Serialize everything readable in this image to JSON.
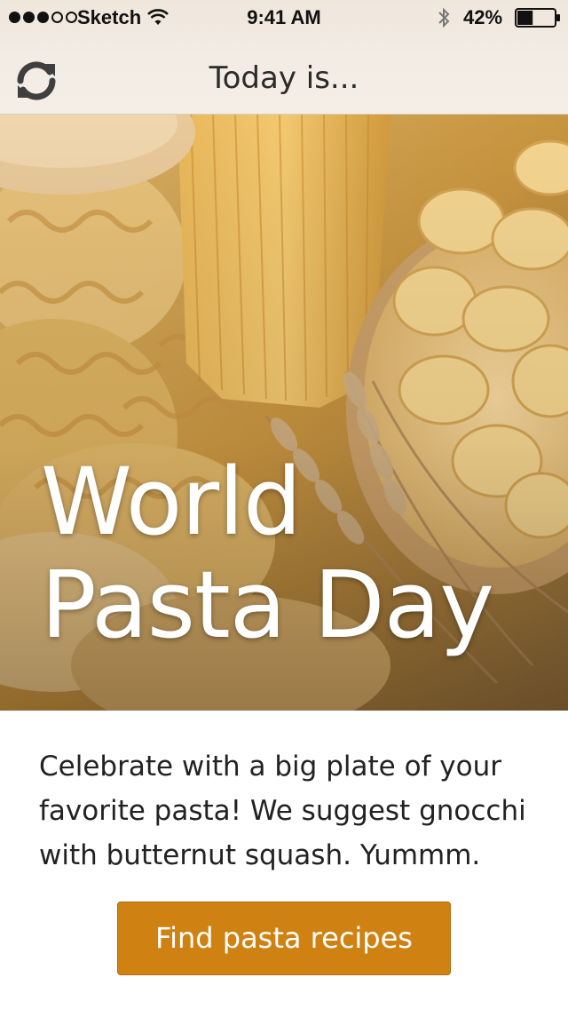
{
  "status_bar": {
    "carrier": "Sketch",
    "time": "9:41 AM",
    "battery": "42%",
    "signal_strength": 3,
    "signal_max": 5,
    "battery_level": 0.42
  },
  "nav": {
    "title": "Today is...",
    "refresh_icon": "refresh-icon"
  },
  "hero": {
    "title_line1": "World",
    "title_line2": "Pasta Day",
    "image": "pasta-photo"
  },
  "content": {
    "description": "Celebrate with a big plate of your favorite pasta! We suggest gnocchi with butternut squash. Yummm.",
    "button_label": "Find pasta recipes"
  },
  "colors": {
    "accent": "#cf8212",
    "header_bg": "#f3ece4",
    "text": "#222222"
  }
}
